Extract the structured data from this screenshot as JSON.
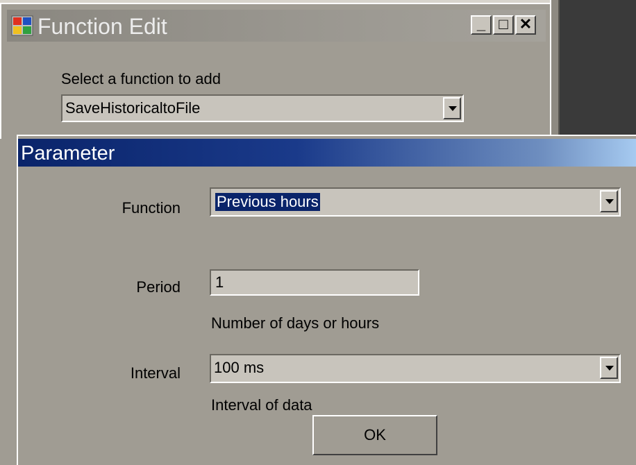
{
  "function_edit": {
    "title": "Function Edit",
    "select_label": "Select a function to add",
    "selected_function": "SaveHistoricaltoFile",
    "caption_minimize": "_",
    "caption_maximize": "□",
    "caption_close": "✕"
  },
  "parameter": {
    "title": "Parameter",
    "function_label": "Function",
    "function_value": "Previous hours",
    "period_label": "Period",
    "period_value": "1",
    "period_hint": "Number of days or hours",
    "interval_label": "Interval",
    "interval_value": "100 ms",
    "interval_hint": "Interval of data",
    "ok_label": "OK"
  },
  "colors": {
    "dialog_bg": "#a09c93",
    "param_title_start": "#0a246a",
    "param_title_end": "#a6caf0",
    "selection": "#0a246a"
  }
}
